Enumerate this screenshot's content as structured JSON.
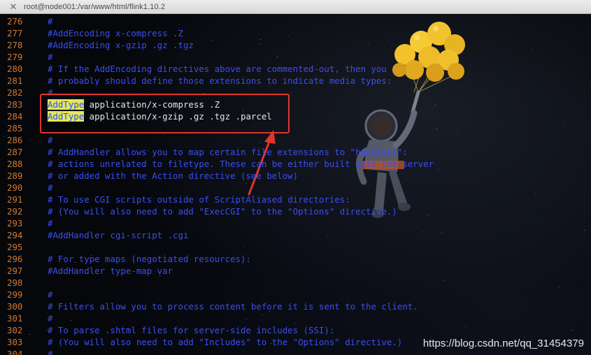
{
  "window": {
    "title": "root@node001:/var/www/html/flink1.10.2"
  },
  "lines": [
    {
      "n": "276",
      "text": "#"
    },
    {
      "n": "277",
      "text": "#AddEncoding x-compress .Z"
    },
    {
      "n": "278",
      "text": "#AddEncoding x-gzip .gz .tgz"
    },
    {
      "n": "279",
      "text": "#"
    },
    {
      "n": "280",
      "text": "# If the AddEncoding directives above are commented-out, then you"
    },
    {
      "n": "281",
      "text": "# probably should define those extensions to indicate media types:"
    },
    {
      "n": "282",
      "text": "#"
    },
    {
      "n": "283",
      "kw": "AddType",
      "rest": " application/x-compress .Z"
    },
    {
      "n": "284",
      "kw": "AddType",
      "rest": " application/x-gzip .gz .tgz .parcel"
    },
    {
      "n": "285",
      "text": ""
    },
    {
      "n": "286",
      "text": "#"
    },
    {
      "n": "287",
      "text": "# AddHandler allows you to map certain file extensions to \"handlers\":"
    },
    {
      "n": "288",
      "text": "# actions unrelated to filetype. These can be either built into the server"
    },
    {
      "n": "289",
      "text": "# or added with the Action directive (see below)"
    },
    {
      "n": "290",
      "text": "#"
    },
    {
      "n": "291",
      "text": "# To use CGI scripts outside of ScriptAliased directories:"
    },
    {
      "n": "292",
      "text": "# (You will also need to add \"ExecCGI\" to the \"Options\" directive.)"
    },
    {
      "n": "293",
      "text": "#"
    },
    {
      "n": "294",
      "text": "#AddHandler cgi-script .cgi"
    },
    {
      "n": "295",
      "text": ""
    },
    {
      "n": "296",
      "text": "# For type maps (negotiated resources):"
    },
    {
      "n": "297",
      "text": "#AddHandler type-map var"
    },
    {
      "n": "298",
      "text": ""
    },
    {
      "n": "299",
      "text": "#"
    },
    {
      "n": "300",
      "text": "# Filters allow you to process content before it is sent to the client."
    },
    {
      "n": "301",
      "text": "#"
    },
    {
      "n": "302",
      "text": "# To parse .shtml files for server-side includes (SSI):"
    },
    {
      "n": "303",
      "text": "# (You will also need to add \"Includes\" to the \"Options\" directive.)"
    },
    {
      "n": "304",
      "text": "#"
    }
  ],
  "watermark": "https://blog.csdn.net/qq_31454379",
  "colors": {
    "line_number": "#d2782f",
    "comment": "#3b4ef0",
    "plain": "#e6e6e6",
    "keyword_bg": "#e6e65a",
    "annotation": "#e0352a"
  },
  "icons": {
    "close": "close-icon"
  }
}
